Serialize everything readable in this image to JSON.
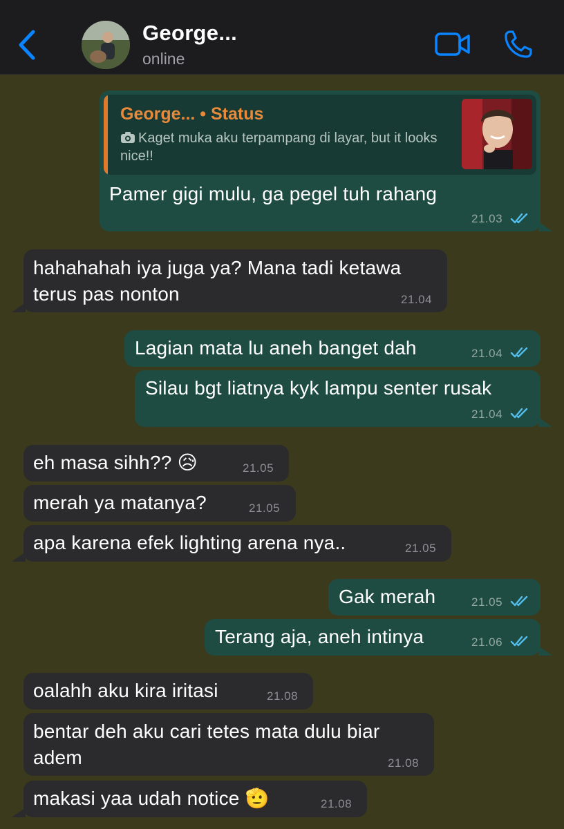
{
  "header": {
    "name": "George...",
    "status": "online",
    "back_icon": "chevron-left-icon",
    "video_icon": "video-camera-icon",
    "call_icon": "phone-icon",
    "accent_color": "#0a84ff"
  },
  "messages": [
    {
      "direction": "outgoing",
      "reply": {
        "name": "George... • Status",
        "text": "Kaget muka aku terpampang di layar, but it looks nice!!",
        "icon": "camera-icon"
      },
      "text": "Pamer gigi mulu, ga pegel tuh rahang",
      "time": "21.03",
      "read": true
    },
    {
      "direction": "incoming",
      "lines": [
        "hahahahah iya juga ya? Mana tadi ketawa",
        "terus pas nonton"
      ],
      "time": "21.04"
    },
    {
      "direction": "outgoing",
      "text": "Lagian mata lu aneh banget dah",
      "time": "21.04",
      "read": true
    },
    {
      "direction": "outgoing",
      "text": "Silau bgt liatnya kyk lampu senter rusak",
      "time": "21.04",
      "read": true
    },
    {
      "direction": "incoming",
      "text": "eh masa sihh?? 😥",
      "time": "21.05"
    },
    {
      "direction": "incoming",
      "text": "merah ya matanya?",
      "time": "21.05"
    },
    {
      "direction": "incoming",
      "text": "apa karena efek lighting arena nya..",
      "time": "21.05"
    },
    {
      "direction": "outgoing",
      "text": "Gak merah",
      "time": "21.05",
      "read": true
    },
    {
      "direction": "outgoing",
      "text": "Terang aja, aneh intinya",
      "time": "21.06",
      "read": true
    },
    {
      "direction": "incoming",
      "text": "oalahh aku kira iritasi",
      "time": "21.08"
    },
    {
      "direction": "incoming",
      "lines": [
        "bentar deh aku cari tetes mata dulu biar",
        "adem"
      ],
      "time": "21.08"
    },
    {
      "direction": "incoming",
      "text": "makasi yaa udah notice 🫡",
      "time": "21.08"
    }
  ]
}
